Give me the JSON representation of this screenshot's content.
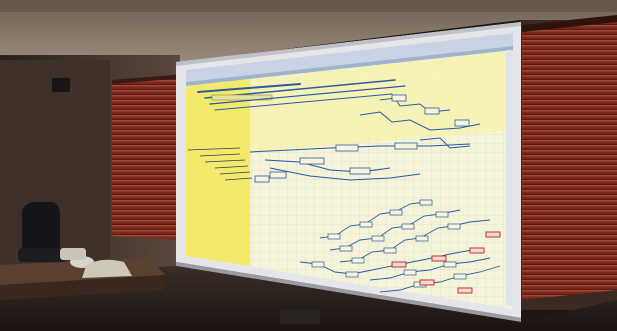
{
  "scene": {
    "description_tag": "photo",
    "colors": {
      "wall": "#4a3a32",
      "ceiling": "#7a6a5e",
      "blind": "#7a2a1c",
      "screen_frame": "#e8e8ea",
      "yellow_panel": "#f6ef7a",
      "grid_area": "#f7f5d6",
      "diagram_blue": "#2a5aa8",
      "diagram_red": "#b4282a",
      "ribbon": "#c9d6e8"
    },
    "icons": [
      "projector-screen",
      "window-blind-left",
      "window-blind-right",
      "desk",
      "chair",
      "ceiling-speaker"
    ]
  }
}
